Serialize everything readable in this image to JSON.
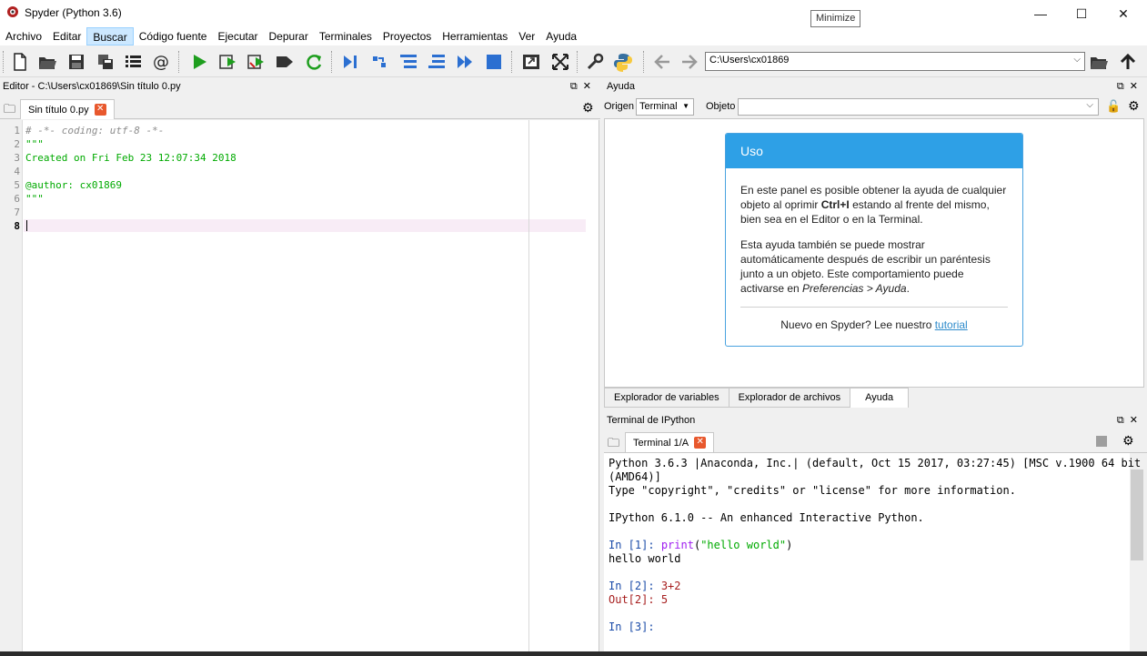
{
  "window": {
    "title": "Spyder (Python 3.6)",
    "tooltip": "Minimize",
    "min_glyph": "—",
    "max_glyph": "☐",
    "close_glyph": "✕"
  },
  "menubar": {
    "items": [
      "Archivo",
      "Editar",
      "Buscar",
      "Código fuente",
      "Ejecutar",
      "Depurar",
      "Terminales",
      "Proyectos",
      "Herramientas",
      "Ver",
      "Ayuda"
    ],
    "active_index": 2
  },
  "toolbar": {
    "working_dir": "C:\\Users\\cx01869",
    "icons": [
      "new-file-icon",
      "open-file-icon",
      "save-icon",
      "save-all-icon",
      "outline-icon",
      "at-icon",
      "run-icon",
      "run-cell-icon",
      "run-cell-advance-icon",
      "run-selection-icon",
      "rerun-icon",
      "debug-icon",
      "step-icon",
      "step-into-icon",
      "step-return-icon",
      "continue-icon",
      "stop-icon",
      "maximize-pane-icon",
      "fullscreen-icon",
      "preferences-icon",
      "python-path-icon",
      "back-icon",
      "forward-icon",
      "browse-folder-icon",
      "parent-dir-icon"
    ]
  },
  "editor": {
    "pane_title": "Editor - C:\\Users\\cx01869\\Sin título 0.py",
    "tab_label": "Sin título 0.py",
    "current_line": 8,
    "line_numbers": [
      "1",
      "2",
      "3",
      "4",
      "5",
      "6",
      "7",
      "8"
    ],
    "lines": [
      "# -*- coding: utf-8 -*-",
      "\"\"\"",
      "Created on Fri Feb 23 12:07:34 2018",
      "",
      "@author: cx01869",
      "\"\"\"",
      "",
      ""
    ]
  },
  "help": {
    "pane_title": "Ayuda",
    "origin_label": "Origen",
    "origin_value": "Terminal",
    "object_label": "Objeto",
    "object_value": "",
    "card_title": "Uso",
    "para1_a": "En este panel es posible obtener la ayuda de cualquier objeto al oprimir ",
    "para1_b": "Ctrl+I",
    "para1_c": " estando al frente del mismo, bien sea en el Editor o en la Terminal.",
    "para2_a": "Esta ayuda también se puede mostrar automáticamente después de escribir un paréntesis junto a un objeto. Este comportamiento puede activarse en ",
    "para2_b": "Preferencias > Ayuda",
    "para2_c": ".",
    "footer_text": "Nuevo en Spyder? Lee nuestro ",
    "footer_link": "tutorial",
    "bottom_tabs": [
      "Explorador de variables",
      "Explorador de archivos",
      "Ayuda"
    ],
    "active_bottom_tab": 2
  },
  "terminal": {
    "pane_title": "Terminal de IPython",
    "tab_label": "Terminal 1/A",
    "banner1": "Python 3.6.3 |Anaconda, Inc.| (default, Oct 15 2017, 03:27:45) [MSC v.1900 64 bit",
    "banner2": "(AMD64)]",
    "banner3": "Type \"copyright\", \"credits\" or \"license\" for more information.",
    "banner4": "IPython 6.1.0 -- An enhanced Interactive Python.",
    "in1_prompt": "In [",
    "in1_num": "1",
    "in1_close": "]: ",
    "in1_fn": "print",
    "in1_open": "(",
    "in1_str": "\"hello world\"",
    "in1_end": ")",
    "out1": "hello world",
    "in2_prompt": "In [",
    "in2_num": "2",
    "in2_close": "]: ",
    "in2_code": "3+2",
    "out2_prompt": "Out[",
    "out2_num": "2",
    "out2_close": "]: ",
    "out2_value": "5",
    "in3_prompt": "In [",
    "in3_num": "3",
    "in3_close": "]: "
  },
  "colors": {
    "accent": "#2ea0e6",
    "run_green": "#1e9e1e",
    "debug_blue": "#2b6fd1",
    "close_tab": "#e8582d"
  }
}
